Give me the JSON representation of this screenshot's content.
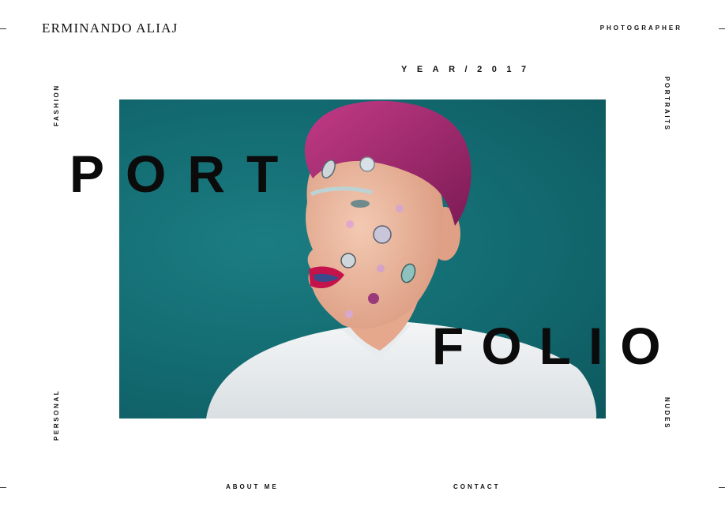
{
  "brand": {
    "name": "ERMINANDO ALIAJ"
  },
  "header": {
    "role": "PHOTOGRAPHER",
    "year": "YEAR/2017"
  },
  "side_nav": {
    "left_top": "FASHION",
    "left_bottom": "PERSONAL",
    "right_top": "PORTRAITS",
    "right_bottom": "NUDES"
  },
  "hero": {
    "word_top": "PORT",
    "word_bottom": "FOLIO"
  },
  "footer_nav": {
    "about": "ABOUT ME",
    "contact": "CONTACT"
  },
  "colors": {
    "background": "#ffffff",
    "text": "#111111",
    "photo_backdrop": "#126a70",
    "hair": "#a12a6a"
  }
}
